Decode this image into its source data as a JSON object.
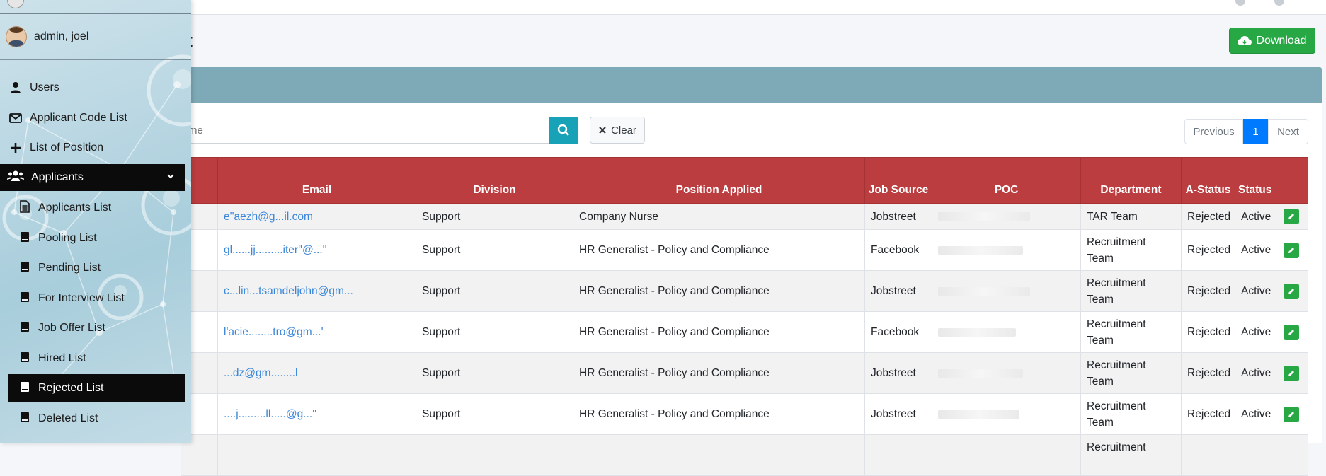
{
  "user": {
    "name": "admin, joel"
  },
  "page": {
    "title": "st"
  },
  "actions": {
    "download_label": "Download"
  },
  "search": {
    "placeholder": "me",
    "clear_label": "Clear"
  },
  "pagination": {
    "previous": "Previous",
    "current": "1",
    "next": "Next"
  },
  "sidebar": {
    "items": [
      {
        "label": "Users",
        "icon": "user-icon"
      },
      {
        "label": "Applicant Code List",
        "icon": "envelope-icon"
      },
      {
        "label": "List of Position",
        "icon": "plus-icon"
      }
    ],
    "active_group": {
      "label": "Applicants",
      "icon": "users-icon"
    },
    "sub_items": [
      {
        "label": "Applicants List",
        "icon": "file-text-icon"
      },
      {
        "label": "Pooling List",
        "icon": "book-icon"
      },
      {
        "label": "Pending List",
        "icon": "book-icon"
      },
      {
        "label": "For Interview List",
        "icon": "book-icon"
      },
      {
        "label": "Job Offer List",
        "icon": "book-icon"
      },
      {
        "label": "Hired List",
        "icon": "book-icon"
      },
      {
        "label": "Rejected List",
        "icon": "book-icon"
      },
      {
        "label": "Deleted List",
        "icon": "book-icon"
      }
    ]
  },
  "table": {
    "columns": [
      "",
      "Email",
      "Division",
      "Position Applied",
      "Job Source",
      "POC",
      "Department",
      "A-Status",
      "Status",
      ""
    ],
    "rows": [
      {
        "email": "e''aezh@g...il.com",
        "division": "Support",
        "position": "Company Nurse",
        "source": "Jobstreet",
        "department": "TAR Team",
        "astatus": "Rejected",
        "status": "Active"
      },
      {
        "email": "gl......jj.........iter''@...''",
        "division": "Support",
        "position": "HR Generalist - Policy and Compliance",
        "source": "Facebook",
        "department": "Recruitment Team",
        "astatus": "Rejected",
        "status": "Active"
      },
      {
        "email": "c...lin...tsamdeljohn@gm...",
        "division": "Support",
        "position": "HR Generalist - Policy and Compliance",
        "source": "Jobstreet",
        "department": "Recruitment Team",
        "astatus": "Rejected",
        "status": "Active"
      },
      {
        "email": "l'acie........tro@gm...'",
        "division": "Support",
        "position": "HR Generalist - Policy and Compliance",
        "source": "Facebook",
        "department": "Recruitment Team",
        "astatus": "Rejected",
        "status": "Active"
      },
      {
        "email": "...dz@gm........l",
        "division": "Support",
        "position": "HR Generalist - Policy and Compliance",
        "source": "Jobstreet",
        "department": "Recruitment Team",
        "astatus": "Rejected",
        "status": "Active"
      },
      {
        "email": "....j.........ll.....@g...''",
        "division": "Support",
        "position": "HR Generalist - Policy and Compliance",
        "source": "Jobstreet",
        "department": "Recruitment Team",
        "astatus": "Rejected",
        "status": "Active"
      },
      {
        "email": "",
        "division": "",
        "position": "",
        "source": "",
        "department": "Recruitment",
        "astatus": "",
        "status": ""
      }
    ]
  }
}
